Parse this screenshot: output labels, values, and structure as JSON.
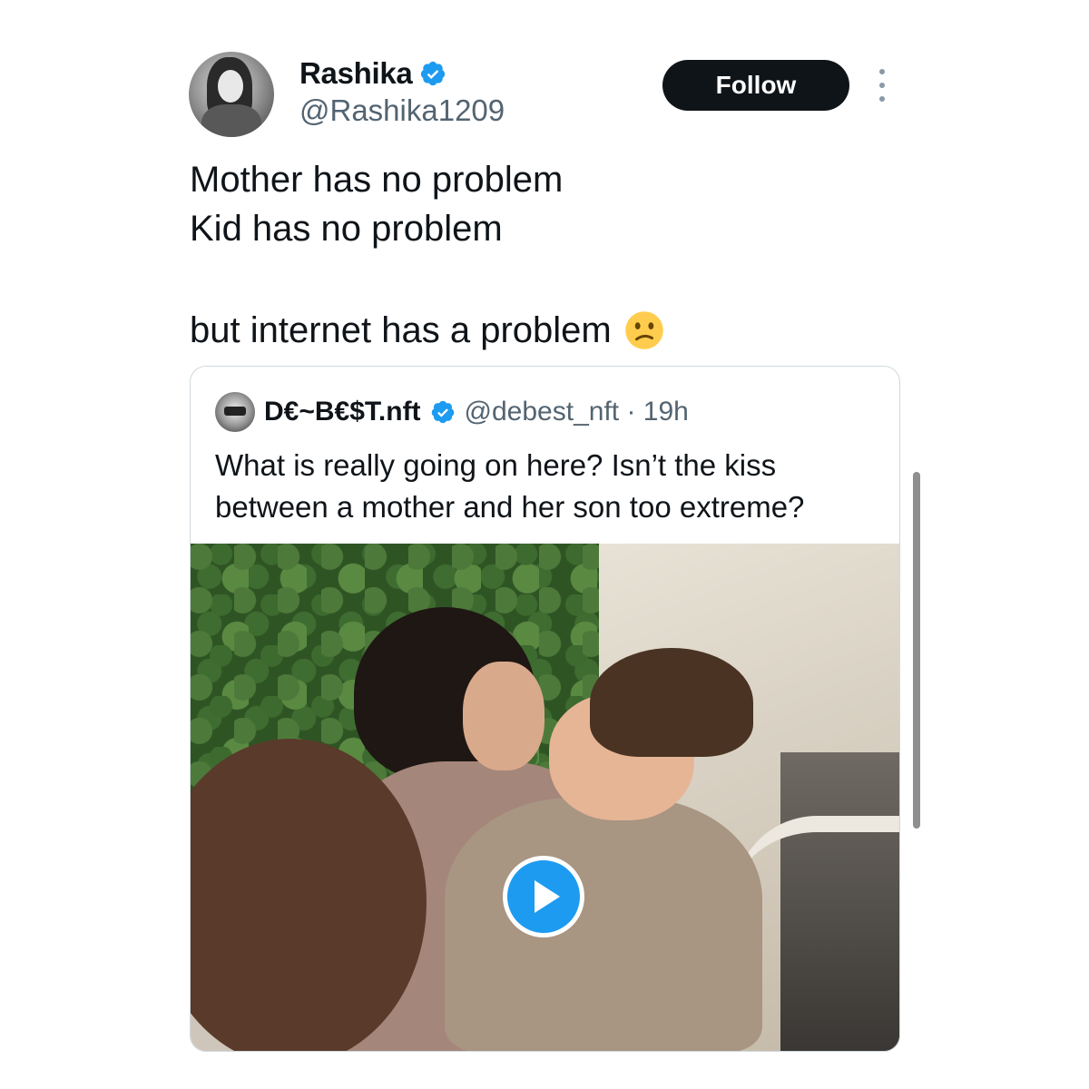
{
  "author": {
    "display_name": "Rashika",
    "handle": "@Rashika1209",
    "verified_icon": "verified-badge-icon",
    "verified_color": "#1d9bf0"
  },
  "actions": {
    "follow_label": "Follow",
    "more_icon": "more-vertical-icon"
  },
  "tweet": {
    "lines": [
      "Mother has no problem",
      "Kid has no problem",
      "but internet has a problem"
    ],
    "emoji": "confused-face-emoji"
  },
  "quoted": {
    "display_name": "D€~B€$T.nft",
    "handle_time": "@debest_nft · 19h",
    "text": "What is really going on here? Isn’t the kiss between a mother and her son too extreme?",
    "media_icon": "play-icon",
    "accent": "#1d9bf0"
  }
}
